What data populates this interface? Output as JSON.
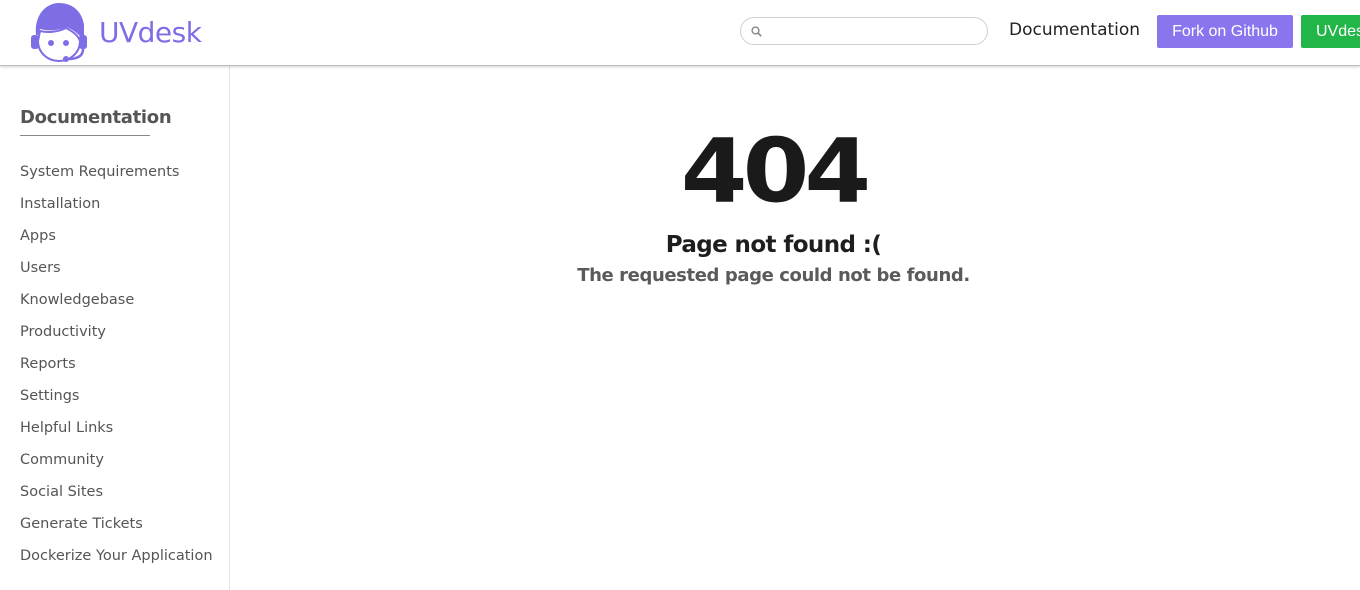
{
  "header": {
    "logo_text": "UVdesk",
    "search_placeholder": "",
    "search_value": "",
    "nav_documentation": "Documentation",
    "fork_button": "Fork on Github",
    "uvdesk_button": "UVdesk"
  },
  "sidebar": {
    "title": "Documentation",
    "items": [
      "System Requirements",
      "Installation",
      "Apps",
      "Users",
      "Knowledgebase",
      "Productivity",
      "Reports",
      "Settings",
      "Helpful Links",
      "Community",
      "Social Sites",
      "Generate Tickets",
      "Dockerize Your Application"
    ]
  },
  "error": {
    "code": "404",
    "title": "Page not found :(",
    "message": "The requested page could not be found."
  },
  "colors": {
    "brand_purple": "#7e6ee6",
    "fork_button_bg": "#8a75ef",
    "uvdesk_button_bg": "#22b548"
  },
  "icons": {
    "logo": "support-agent-headset-icon",
    "search": "search-icon"
  }
}
